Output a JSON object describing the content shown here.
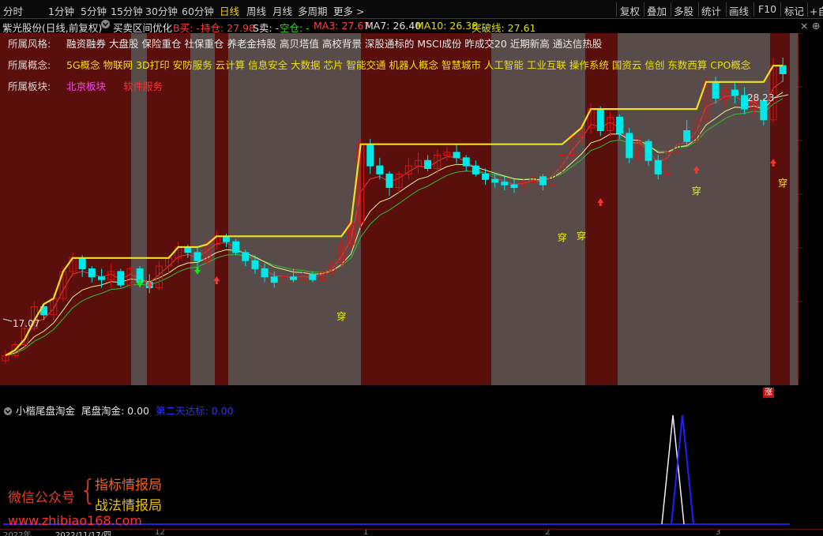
{
  "toolbar": {
    "periods": [
      "分时",
      "1分钟",
      "5分钟",
      "15分钟",
      "30分钟",
      "60分钟",
      "日线",
      "周线",
      "月线",
      "多周期",
      "更多 >"
    ],
    "active_period": "日线",
    "right_buttons": [
      "复权",
      "叠加",
      "多股",
      "统计",
      "画线",
      "F10",
      "标记",
      "+自"
    ]
  },
  "infobar": {
    "stock_title": "紫光股份(日线,前复权)",
    "indicator_name": "买卖区间优化",
    "b_label": "B买: -",
    "hold_label": "持仓: 27.98",
    "s_label": "S卖: -",
    "empty_label": "空仓: -",
    "ma3": "MA3: 27.67",
    "ma7": "MA7: 26.40",
    "ma10": "MA10: 26.38",
    "breakout": "突破线: 27.61"
  },
  "overlay": {
    "style_label": "所属风格:",
    "style_text": "融资融券 大盘股 保险重仓 社保重仓 养老金持股 高贝塔值 高校背景 深股通标的 MSCI成份 昨成交20 近期新高 通达信热股",
    "concept_label": "所属概念:",
    "concept_text": "5G概念 物联网 3D打印 安防服务 云计算 信息安全 大数据 芯片 智能交通 机器人概念 智慧城市 人工智能 工业互联 操作系统 国资云 信创 东数西算 CPO概念",
    "sector_label": "所属板块:",
    "sector_1": "北京板块",
    "sector_2": "软件服务"
  },
  "chart_labels": {
    "high": "28.23",
    "low": "17.07",
    "signal": "穿",
    "zhang": "涨"
  },
  "subpane": {
    "title": "小楷尾盘淘金",
    "value_label": "尾盘淘金: 0.00",
    "second_label": "第二天达标: 0.00"
  },
  "watermark": {
    "wechat": "微信公众号",
    "line1": "指标情报局",
    "line2": "战法情报局",
    "url": "www.zhibiao168.com"
  },
  "bottom_axis": {
    "year": "2022年",
    "date": "2022/11/17/四",
    "ticks": [
      "12",
      "1",
      "2",
      "3"
    ]
  },
  "colors": {
    "bg_red": "#5a0f0c",
    "bg_gray": "#574c4a",
    "up": "#e01010",
    "down": "#00e8e8",
    "breakout_line": "#f0e020",
    "ma3": "#e04040",
    "ma7": "#f0f090",
    "ma10": "#30c030"
  },
  "chart_data": {
    "type": "candlestick",
    "ohlc": [
      [
        17.1,
        17.5,
        17.0,
        17.3
      ],
      [
        17.3,
        17.8,
        17.2,
        17.7
      ],
      [
        17.7,
        18.5,
        17.6,
        18.3
      ],
      [
        18.3,
        19.3,
        18.2,
        19.1
      ],
      [
        19.1,
        19.2,
        18.6,
        18.8
      ],
      [
        18.8,
        19.6,
        18.6,
        19.4
      ],
      [
        19.4,
        20.6,
        19.3,
        20.4
      ],
      [
        20.4,
        21.1,
        20.2,
        20.9
      ],
      [
        20.9,
        21.0,
        20.2,
        20.5
      ],
      [
        20.5,
        20.6,
        20.0,
        20.2
      ],
      [
        20.2,
        20.5,
        19.8,
        20.1
      ],
      [
        20.1,
        20.7,
        19.8,
        20.4
      ],
      [
        20.4,
        20.5,
        19.8,
        19.9
      ],
      [
        19.9,
        20.6,
        19.8,
        20.5
      ],
      [
        20.5,
        20.6,
        19.8,
        20.0
      ],
      [
        20.0,
        20.3,
        19.6,
        19.8
      ],
      [
        19.8,
        20.8,
        19.7,
        20.6
      ],
      [
        20.6,
        21.0,
        20.3,
        20.9
      ],
      [
        20.9,
        21.5,
        20.7,
        21.3
      ],
      [
        21.3,
        21.4,
        20.9,
        21.1
      ],
      [
        21.1,
        21.3,
        20.6,
        20.8
      ],
      [
        20.8,
        21.6,
        20.6,
        21.4
      ],
      [
        21.4,
        21.9,
        21.2,
        21.7
      ],
      [
        21.7,
        21.8,
        21.3,
        21.5
      ],
      [
        21.5,
        21.6,
        21.0,
        21.1
      ],
      [
        21.1,
        21.2,
        20.6,
        20.8
      ],
      [
        20.8,
        21.0,
        20.3,
        20.5
      ],
      [
        20.5,
        20.7,
        20.0,
        20.2
      ],
      [
        20.2,
        20.4,
        19.8,
        20.0
      ],
      [
        20.0,
        20.4,
        19.8,
        20.2
      ],
      [
        20.2,
        20.5,
        20.0,
        20.1
      ],
      [
        20.1,
        20.4,
        19.9,
        20.3
      ],
      [
        20.3,
        20.4,
        20.0,
        20.1
      ],
      [
        20.1,
        20.5,
        20.0,
        20.4
      ],
      [
        20.4,
        20.8,
        20.2,
        20.7
      ],
      [
        20.7,
        21.6,
        20.6,
        21.4
      ],
      [
        21.4,
        22.4,
        21.2,
        22.2
      ],
      [
        22.2,
        25.3,
        22.0,
        25.1
      ],
      [
        25.1,
        25.3,
        24.0,
        24.3
      ],
      [
        24.3,
        24.6,
        23.8,
        24.0
      ],
      [
        24.0,
        24.1,
        23.2,
        23.5
      ],
      [
        23.5,
        24.1,
        23.3,
        24.0
      ],
      [
        24.0,
        24.6,
        23.8,
        24.3
      ],
      [
        24.3,
        24.8,
        24.0,
        24.5
      ],
      [
        24.5,
        24.7,
        24.1,
        24.2
      ],
      [
        24.2,
        24.9,
        24.0,
        24.7
      ],
      [
        24.7,
        25.0,
        24.5,
        24.8
      ],
      [
        24.8,
        25.1,
        24.4,
        24.6
      ],
      [
        24.6,
        24.7,
        24.1,
        24.3
      ],
      [
        24.3,
        24.5,
        23.9,
        24.0
      ],
      [
        24.0,
        24.2,
        23.6,
        23.8
      ],
      [
        23.8,
        24.0,
        23.5,
        23.7
      ],
      [
        23.7,
        23.9,
        23.4,
        23.6
      ],
      [
        23.6,
        23.8,
        23.3,
        23.5
      ],
      [
        23.5,
        23.9,
        23.3,
        23.7
      ],
      [
        23.7,
        24.1,
        23.5,
        23.9
      ],
      [
        23.9,
        24.0,
        23.4,
        23.6
      ],
      [
        23.6,
        24.3,
        23.5,
        24.2
      ],
      [
        24.2,
        24.9,
        24.0,
        24.7
      ],
      [
        24.7,
        25.6,
        24.5,
        25.4
      ],
      [
        25.4,
        25.9,
        25.1,
        25.7
      ],
      [
        25.7,
        26.6,
        25.5,
        26.4
      ],
      [
        26.4,
        26.5,
        25.4,
        25.6
      ],
      [
        25.6,
        26.3,
        25.4,
        26.1
      ],
      [
        26.1,
        26.2,
        25.3,
        25.5
      ],
      [
        25.5,
        25.7,
        24.4,
        24.6
      ],
      [
        24.6,
        25.4,
        24.4,
        25.2
      ],
      [
        25.2,
        25.3,
        24.3,
        24.5
      ],
      [
        24.5,
        24.7,
        23.8,
        24.0
      ],
      [
        24.0,
        25.0,
        23.9,
        24.8
      ],
      [
        24.8,
        25.8,
        24.7,
        25.6
      ],
      [
        25.6,
        26.0,
        25.0,
        25.2
      ],
      [
        25.2,
        26.2,
        25.1,
        26.0
      ],
      [
        26.0,
        27.6,
        25.9,
        27.4
      ],
      [
        27.4,
        27.6,
        26.6,
        26.8
      ],
      [
        26.8,
        27.3,
        26.5,
        27.1
      ],
      [
        27.1,
        27.4,
        26.6,
        26.9
      ],
      [
        26.9,
        27.2,
        26.2,
        26.4
      ],
      [
        26.4,
        26.9,
        26.1,
        26.7
      ],
      [
        26.7,
        26.8,
        25.8,
        26.0
      ],
      [
        26.0,
        28.3,
        25.9,
        28.0
      ],
      [
        28.0,
        28.3,
        27.4,
        27.7
      ]
    ],
    "breakout_line": [
      17.3,
      17.5,
      17.9,
      18.6,
      19.2,
      19.4,
      20.4,
      20.9,
      20.9,
      20.9,
      20.9,
      20.9,
      20.9,
      20.9,
      20.9,
      20.9,
      20.9,
      20.9,
      21.3,
      21.3,
      21.3,
      21.4,
      21.7,
      21.7,
      21.7,
      21.7,
      21.7,
      21.7,
      21.7,
      21.7,
      21.7,
      21.7,
      21.7,
      21.7,
      21.7,
      21.7,
      22.2,
      25.1,
      25.1,
      25.1,
      25.1,
      25.1,
      25.1,
      25.1,
      25.1,
      25.1,
      25.1,
      25.1,
      25.1,
      25.1,
      25.1,
      25.1,
      25.1,
      25.1,
      25.1,
      25.1,
      25.1,
      25.1,
      25.1,
      25.4,
      25.7,
      26.4,
      26.4,
      26.4,
      26.4,
      26.4,
      26.4,
      26.4,
      26.4,
      26.4,
      26.4,
      26.4,
      26.4,
      27.4,
      27.4,
      27.4,
      27.4,
      27.4,
      27.4,
      27.4,
      28.0,
      28.0
    ],
    "ylim": [
      16.2,
      29.2
    ],
    "high_label": 28.23,
    "low_label": 17.07
  }
}
